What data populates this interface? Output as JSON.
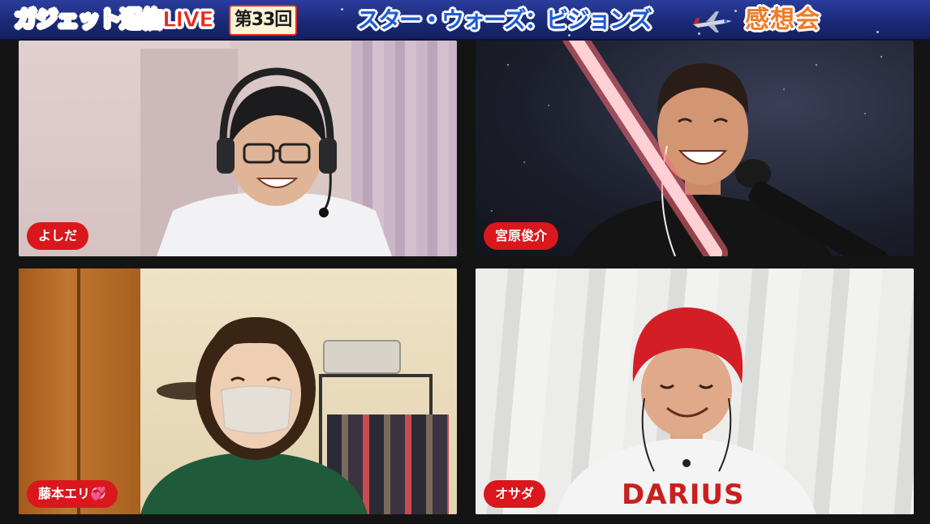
{
  "header": {
    "show_name": "ガジェット通信LIVE",
    "episode": "第33回",
    "topic": "スター・ウォーズ：ビジョンズ",
    "session": "感想会",
    "icon": "fighter-jet-icon"
  },
  "participants": [
    {
      "name": "よしだ"
    },
    {
      "name": "宮原俊介"
    },
    {
      "name": "藤本エリ💞"
    },
    {
      "name": "オサダ"
    }
  ],
  "shirt_text": "DARIUS",
  "colors": {
    "header_bg": "#1b2a78",
    "name_tag_bg": "#d9171c",
    "show_name": "#e8281e",
    "topic": "#1e5bd8",
    "session": "#f07a24"
  }
}
